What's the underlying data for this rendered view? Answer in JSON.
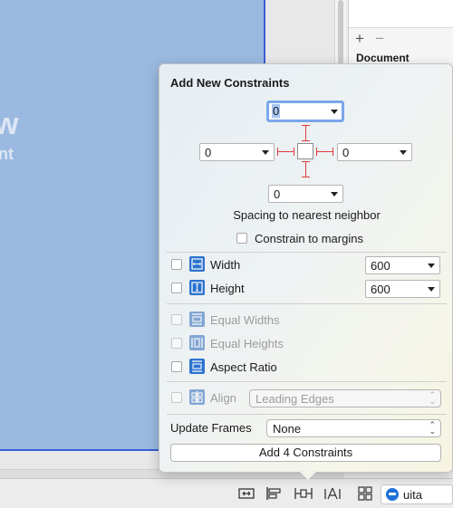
{
  "canvas": {
    "view_label_big": "w",
    "view_label_small": "nt"
  },
  "outline": {
    "add_symbol": "+",
    "remove_symbol": "−",
    "heading": "Document"
  },
  "toolbar": {
    "icons": [
      "update-frames-icon",
      "align-icon",
      "pin-icon",
      "resolve-issues-icon",
      "grid-icon"
    ],
    "scheme_label": "uita"
  },
  "popover": {
    "title": "Add New Constraints",
    "spacing": {
      "top": "0",
      "left": "0",
      "right": "0",
      "bottom": "0",
      "caption": "Spacing to nearest neighbor"
    },
    "constrain_to_margins": {
      "label": "Constrain to margins",
      "checked": false
    },
    "size": [
      {
        "label": "Width",
        "value": "600",
        "enabled": true,
        "checked": false
      },
      {
        "label": "Height",
        "value": "600",
        "enabled": true,
        "checked": false
      }
    ],
    "equal": [
      {
        "label": "Equal Widths",
        "enabled": false,
        "checked": false
      },
      {
        "label": "Equal Heights",
        "enabled": false,
        "checked": false
      },
      {
        "label": "Aspect Ratio",
        "enabled": true,
        "checked": false
      }
    ],
    "align": {
      "label": "Align",
      "value": "Leading Edges",
      "enabled": false
    },
    "update_frames": {
      "label": "Update Frames",
      "value": "None"
    },
    "add_button": "Add 4 Constraints"
  }
}
